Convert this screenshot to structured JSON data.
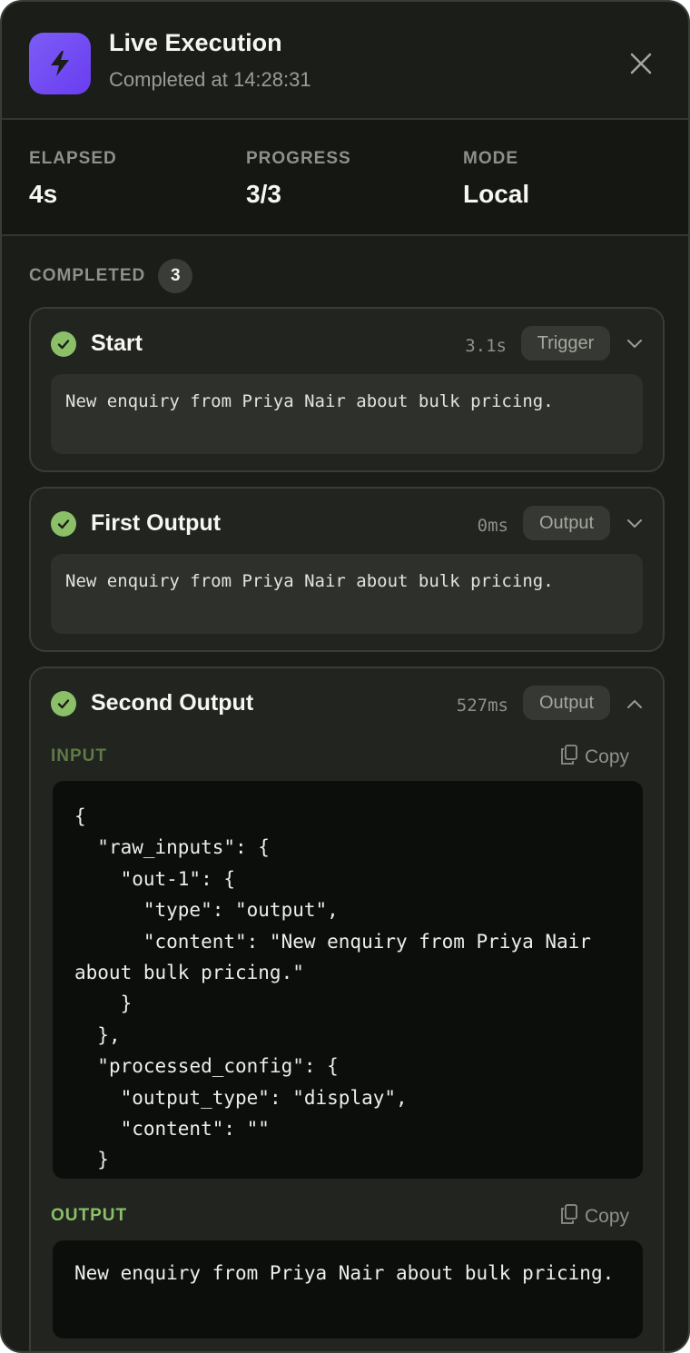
{
  "header": {
    "title": "Live Execution",
    "subtitle": "Completed at 14:28:31",
    "icon": "lightning-bolt-icon",
    "accent": "#7c5cf6"
  },
  "stats": [
    {
      "label": "ELAPSED",
      "value": "4s"
    },
    {
      "label": "PROGRESS",
      "value": "3/3"
    },
    {
      "label": "MODE",
      "value": "Local"
    }
  ],
  "section": {
    "label": "COMPLETED",
    "count": "3"
  },
  "steps": [
    {
      "title": "Start",
      "duration": "3.1s",
      "type": "Trigger",
      "expanded": false,
      "preview": "New enquiry from Priya Nair about bulk pricing."
    },
    {
      "title": "First Output",
      "duration": "0ms",
      "type": "Output",
      "expanded": false,
      "preview": "New enquiry from Priya Nair about bulk pricing."
    },
    {
      "title": "Second Output",
      "duration": "527ms",
      "type": "Output",
      "expanded": true,
      "input_label": "INPUT",
      "input_copy": "Copy",
      "input_json": "{\n  \"raw_inputs\": {\n    \"out-1\": {\n      \"type\": \"output\",\n      \"content\": \"New enquiry from Priya Nair about bulk pricing.\"\n    }\n  },\n  \"processed_config\": {\n    \"output_type\": \"display\",\n    \"content\": \"\"\n  }",
      "output_label": "OUTPUT",
      "output_copy": "Copy",
      "output_text": "New enquiry from Priya Nair about bulk pricing."
    }
  ],
  "colors": {
    "success": "#8bc068",
    "input_label": "#5f7a45",
    "output_label": "#8bc068"
  }
}
